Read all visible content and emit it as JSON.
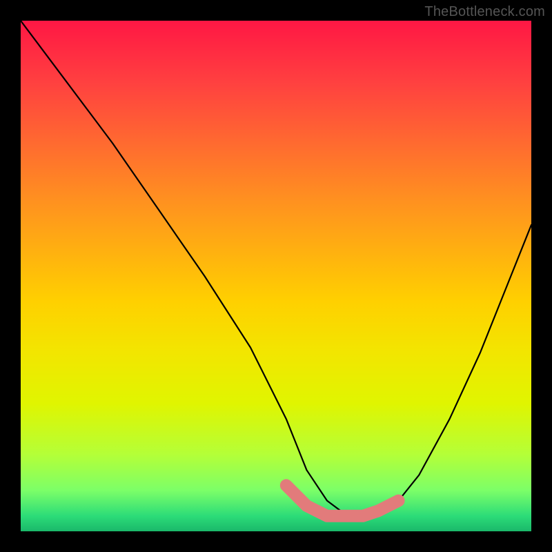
{
  "watermark": "TheBottleneck.com",
  "chart_data": {
    "type": "line",
    "title": "",
    "xlabel": "",
    "ylabel": "",
    "xlim": [
      0,
      100
    ],
    "ylim": [
      0,
      100
    ],
    "series": [
      {
        "name": "bottleneck-curve",
        "x": [
          0,
          9,
          18,
          27,
          36,
          45,
          52,
          56,
          60,
          64,
          67,
          70,
          74,
          78,
          84,
          90,
          96,
          100
        ],
        "values": [
          100,
          88,
          76,
          63,
          50,
          36,
          22,
          12,
          6,
          3,
          3,
          4,
          6,
          11,
          22,
          35,
          50,
          60
        ]
      }
    ],
    "highlight": {
      "name": "trough-highlight",
      "color": "#e27b7b",
      "x": [
        52,
        56,
        60,
        64,
        67,
        70,
        74
      ],
      "values": [
        9,
        5,
        3,
        3,
        3,
        4,
        6
      ]
    },
    "gradient_stops": [
      {
        "pos": 0,
        "color": "#ff1744"
      },
      {
        "pos": 12,
        "color": "#ff4040"
      },
      {
        "pos": 24,
        "color": "#ff6a30"
      },
      {
        "pos": 35,
        "color": "#ff9020"
      },
      {
        "pos": 45,
        "color": "#ffb010"
      },
      {
        "pos": 55,
        "color": "#ffd000"
      },
      {
        "pos": 65,
        "color": "#f2e600"
      },
      {
        "pos": 75,
        "color": "#e0f500"
      },
      {
        "pos": 85,
        "color": "#b4ff38"
      },
      {
        "pos": 92,
        "color": "#7cff68"
      },
      {
        "pos": 97,
        "color": "#2cdc78"
      },
      {
        "pos": 100,
        "color": "#1ab86a"
      }
    ]
  }
}
